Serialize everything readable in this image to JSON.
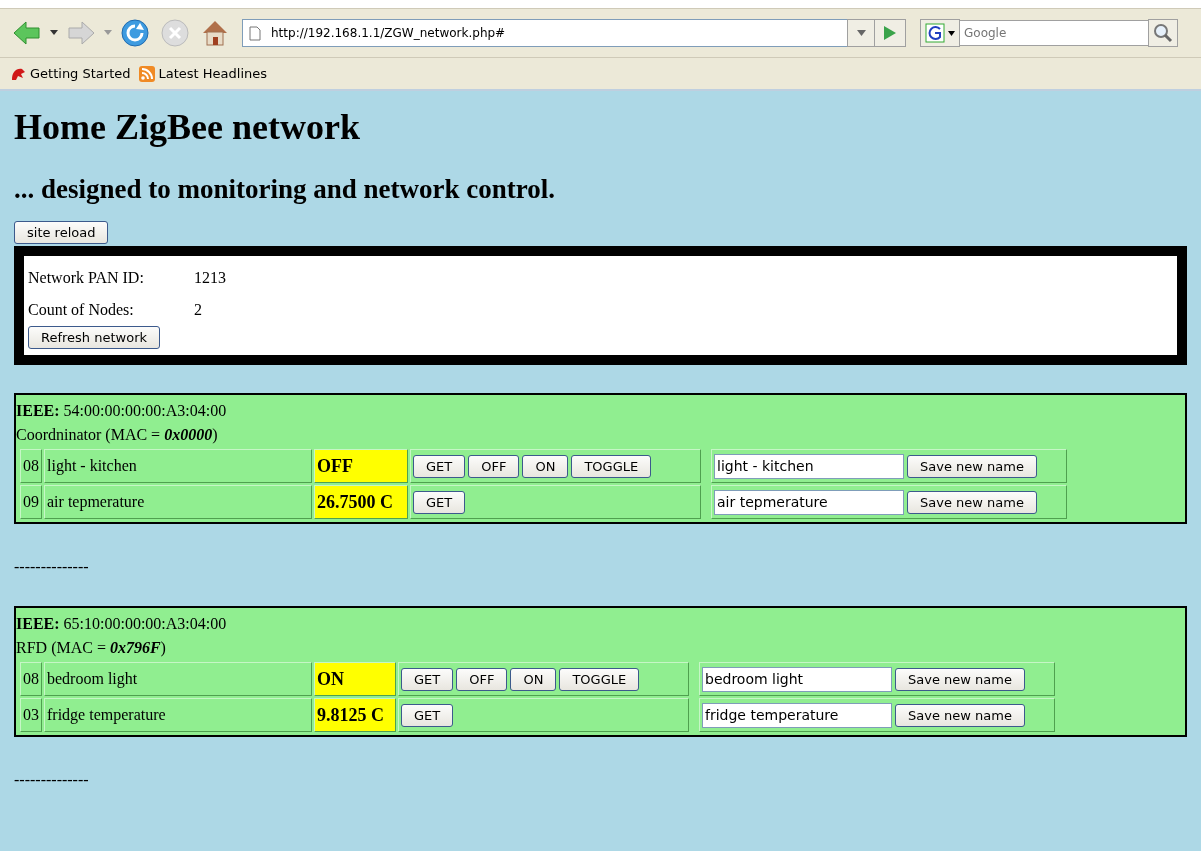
{
  "browser": {
    "url": "http://192.168.1.1/ZGW_network.php#",
    "search_placeholder": "Google",
    "bookmarks": [
      {
        "label": "Getting Started",
        "kind": "site"
      },
      {
        "label": "Latest Headlines",
        "kind": "feed"
      }
    ]
  },
  "page": {
    "heading": "Home ZigBee network",
    "subheading": "... designed to monitoring and network control.",
    "reload_button": "site reload",
    "network": {
      "pan_label": "Network PAN ID:",
      "pan_value": "1213",
      "count_label": "Count of Nodes:",
      "count_value": "2",
      "refresh_button": "Refresh network"
    },
    "nodes": [
      {
        "ieee": "**IEEE:** 54:00:00:00:00:A3:04:00",
        "role": "Coordninator (MAC = *0x0000*)",
        "endpoints": [
          {
            "id": "08",
            "name": "light - kitchen",
            "value": "OFF",
            "actions": [
              "GET",
              "OFF",
              "ON",
              "TOGGLE"
            ],
            "name_field": "light - kitchen",
            "save_button": "Save new name"
          },
          {
            "id": "09",
            "name": "air tepmerature",
            "value": "26.7500 C",
            "actions": [
              "GET"
            ],
            "name_field": "air tepmerature",
            "save_button": "Save new name"
          }
        ],
        "separator": "--------------"
      },
      {
        "ieee": "**IEEE:** 65:10:00:00:00:A3:04:00",
        "role": "RFD (MAC = *0x796F*)",
        "endpoints": [
          {
            "id": "08",
            "name": "bedroom light",
            "value": "ON",
            "actions": [
              "GET",
              "OFF",
              "ON",
              "TOGGLE"
            ],
            "name_field": "bedroom light",
            "save_button": "Save new name"
          },
          {
            "id": "03",
            "name": "fridge temperature",
            "value": "9.8125 C",
            "actions": [
              "GET"
            ],
            "name_field": "fridge temperature",
            "save_button": "Save new name"
          }
        ],
        "separator": "--------------"
      }
    ]
  }
}
